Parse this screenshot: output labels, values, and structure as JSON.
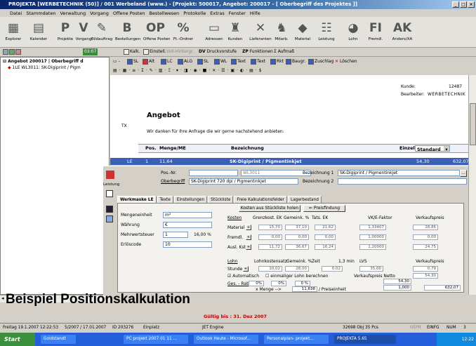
{
  "window": {
    "title": "PROJEKTA [WERBETECHNIK (50)] / 001 Werbeland (www.) - [Projekt: 500017, Angebot: 200017 - [ Oberbegriff des Projektes ]]"
  },
  "menu": [
    "Datei",
    "Stammdaten",
    "Verwaltung",
    "Vorgang",
    "Offene Posten",
    "Bestellwesen",
    "Protokolle",
    "Extras",
    "Fenster",
    "Hilfe"
  ],
  "toolbar_main": [
    {
      "label": "Explorer",
      "icon": "explorer-icon",
      "glyph": "▦"
    },
    {
      "label": "Kalender",
      "icon": "calendar-icon",
      "glyph": "▤"
    },
    {
      "label": "Projekte",
      "icon": "projects-icon",
      "glyph": "P"
    },
    {
      "label": "Vorgang",
      "icon": "process-icon",
      "glyph": "V"
    },
    {
      "label": "Bildauftrag",
      "icon": "image-order-icon",
      "glyph": "✎"
    },
    {
      "label": "Bestellungen",
      "icon": "orders-icon",
      "glyph": "B"
    },
    {
      "label": "Offene Posten",
      "icon": "open-items-icon",
      "glyph": "OP"
    },
    {
      "label": "Ft.-Ordner",
      "icon": "folder-icon",
      "glyph": "%"
    },
    {
      "label": "Adressen",
      "icon": "addresses-icon",
      "glyph": "▭"
    },
    {
      "label": "Kunden",
      "icon": "customers-icon",
      "glyph": "♜"
    },
    {
      "label": "Lieferanten",
      "icon": "suppliers-icon",
      "glyph": "✕"
    },
    {
      "label": "Mitarb.",
      "icon": "staff-icon",
      "glyph": "♞"
    },
    {
      "label": "Material",
      "icon": "material-icon",
      "glyph": "◆"
    },
    {
      "label": "Leistung",
      "icon": "services-icon",
      "glyph": "☷"
    },
    {
      "label": "Lohn",
      "icon": "wage-icon",
      "glyph": "◕"
    },
    {
      "label": "Fremdl.",
      "icon": "external-icon",
      "glyph": "FI"
    },
    {
      "label": "Anders/XA",
      "icon": "other-icon",
      "glyph": "AK"
    }
  ],
  "toolbar_second": {
    "counter": "03:07",
    "items": [
      "Kalk.",
      "Einstell.",
      "Voll-Hintergr.",
      "Druckvorstufe",
      "Funktionen",
      "Aufmaß"
    ],
    "dv_label": "DV",
    "zp_label": "ZP"
  },
  "tree": {
    "root": "Angebot 200017 | Oberbegriff d",
    "child": "1LE WL3011: SK-Digiprint / Pigm"
  },
  "doc_toolbar": {
    "items": [
      "SL",
      "Alt",
      "LC",
      "ALG",
      "SL",
      "WL",
      "Text",
      "Text",
      "Rkt",
      "Baugr.",
      "Zuschlag",
      "Löschen"
    ]
  },
  "document": {
    "kunde_label": "Kunde:",
    "kunde_value": "12487",
    "bearbeiter_label": "Bearbeiter:",
    "bearbeiter_value": "WERBETECHNIK",
    "heading": "Angebot",
    "intro": "Wir danken für Ihre Anfrage die wir gerne nachstehend anbieten:",
    "side_tag": "TX"
  },
  "table": {
    "headers": [
      "Pos.",
      "Menge/ME",
      "Bezeichnung",
      "Einzeln"
    ],
    "dropdown": "Standard",
    "row": {
      "type": "LE",
      "pos": "1",
      "menge": "11,64",
      "bezeichnung": "SK-Digiprint / Pigmentinkjet",
      "einzeln": "54,30",
      "gesamt": "632,07"
    }
  },
  "detail": {
    "side_label": "Leistung",
    "pos_nr_label": "Pos.-Nr.",
    "pos_nr_value": "",
    "code_value": "WL3011",
    "bez1_label": "Bezeichnung 1",
    "bez1_value": "SK-Digiprint / Pigmentinkjet",
    "oberbegriff_label": "Oberbegriff",
    "oberbegriff_value": "SK-Digiprint 720 dpi / Pigmentinkjet",
    "bez2_label": "Bezeichnung 2",
    "bez2_value": "",
    "tabs": [
      "Werkmaske LE",
      "Texte",
      "Einstellungen",
      "Stückliste",
      "Freie Kalkulationsfelder",
      "Lagerbestand"
    ],
    "buttons": {
      "stueckliste": "Kosten aus Stückliste holen",
      "preisfindung": "Preisfindung"
    },
    "left_fields": [
      {
        "label": "Mengeneinheit",
        "value": "m²"
      },
      {
        "label": "Währung",
        "value": "€"
      },
      {
        "label": "Mehrwertsteuer",
        "value": "1",
        "extra": "16,00 %"
      },
      {
        "label": "Erlöscode",
        "value": "10"
      }
    ],
    "cost_headers": [
      "Kosten",
      "Grenzkost. EK",
      "Gemeink. %",
      "Tats. EK",
      "VK/E-Faktor",
      "Verkaufspreis"
    ],
    "cost_rows": [
      {
        "label": "Material",
        "values": [
          "15,70",
          "37,10",
          "21,62",
          "1,33407",
          "28,86"
        ]
      },
      {
        "label": "Fremdl.",
        "values": [
          "0,00",
          "0,00",
          "0,00",
          "1,00000",
          "0,00"
        ]
      },
      {
        "label": "Ausl. Kst.",
        "values": [
          "11,72",
          "36,67",
          "16,24",
          "1,20000",
          "24,75"
        ]
      }
    ],
    "lohn_label": "Lohn",
    "lohn_headers": [
      "Lohnkostensatz",
      "Gemeink. %",
      "Zeit",
      "1,3 min",
      "LVS",
      "Verkaufspreis"
    ],
    "stunde_row": {
      "label": "Stunde",
      "values": [
        "10,02",
        "28,00",
        "0,02",
        "35,00",
        "0,79"
      ]
    },
    "automatisch_label": "Automatisch",
    "einmalig_label": "einmaliger Lohn berechnen",
    "vk_netto_label": "Verkaufspreis Netto",
    "vk_netto_value": "54,30",
    "rabatt_label": "Ges. - Rabatt",
    "rabatt_values": [
      "0%",
      "0%",
      "0 %"
    ],
    "menge_label": "x Menge -->",
    "menge_value": "11,638",
    "preiseinheit_label": "/ Preiseinheit",
    "pe_value": "1,000",
    "summe_value": "632,07"
  },
  "caption": "Beispiel Positionskalkulation",
  "validity": "Gültig bis : 31. Dez 2007",
  "status": {
    "left": "Freitag 19.1.2007 12:22:53",
    "mid1": "5/2007 / 17.01.2007",
    "mid2": "ID 203276",
    "mid3": "Einplatz",
    "engine": "JET Engine",
    "right1": "32698 Obj 35 Pcs",
    "right2": "GEPR",
    "right3": "EINFG",
    "right4": "NUM",
    "right5": "3"
  },
  "taskbar": {
    "start": "Start",
    "tasks": [
      "Goldstandt",
      "PC projekt 2007 01 11 ...",
      "Outlook Heute - Microsof...",
      "Personalplan- projekt...",
      "PROJEKTA 5.65"
    ],
    "clock": "12:22"
  }
}
